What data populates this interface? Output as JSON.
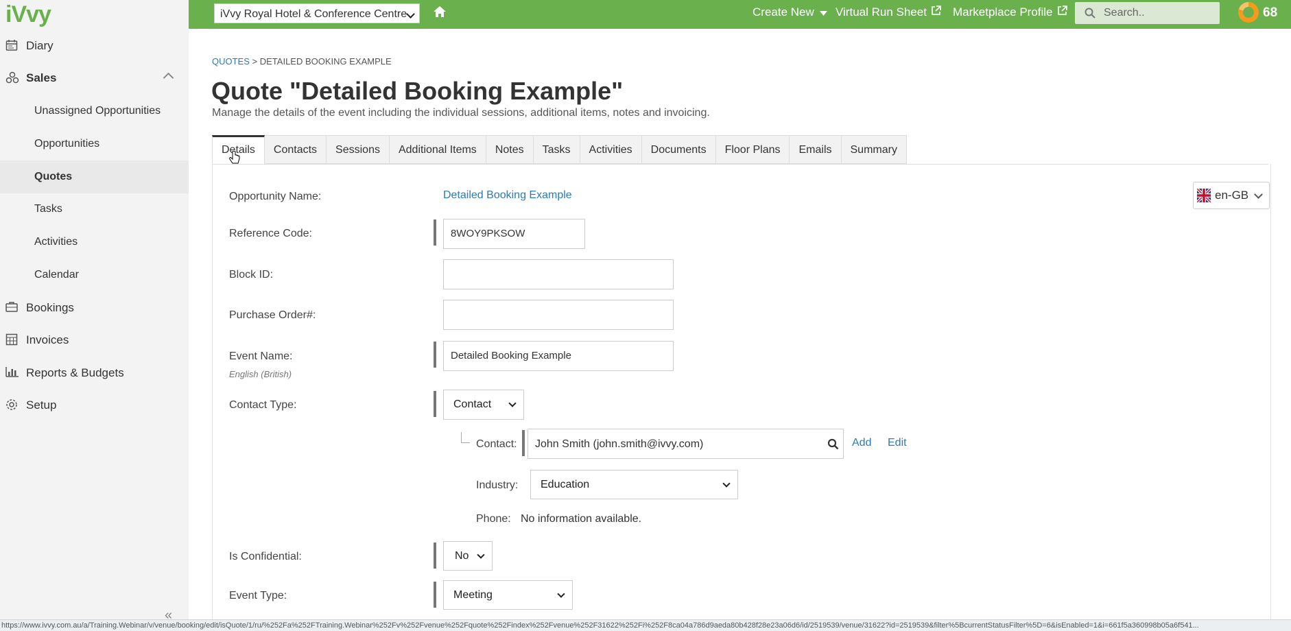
{
  "app": {
    "logo": "iVvy"
  },
  "sidebar": {
    "items": [
      {
        "label": "Diary",
        "icon": "calendar-icon"
      },
      {
        "label": "Sales",
        "icon": "sales-icon"
      },
      {
        "label": "Unassigned Opportunities"
      },
      {
        "label": "Opportunities"
      },
      {
        "label": "Quotes"
      },
      {
        "label": "Tasks"
      },
      {
        "label": "Activities"
      },
      {
        "label": "Calendar"
      },
      {
        "label": "Bookings",
        "icon": "briefcase-icon"
      },
      {
        "label": "Invoices",
        "icon": "calculator-icon"
      },
      {
        "label": "Reports & Budgets",
        "icon": "bar-chart-icon"
      },
      {
        "label": "Setup",
        "icon": "gear-icon"
      }
    ],
    "collapse_glyph": "«"
  },
  "topbar": {
    "venue": "iVvy Royal Hotel & Conference Centre",
    "create_new": "Create New",
    "virtual_run_sheet": "Virtual Run Sheet",
    "marketplace_profile": "Marketplace Profile",
    "search_placeholder": "Search..",
    "score": "68",
    "colors": {
      "bar": "#6ab04c",
      "accent": "#f29b1f"
    }
  },
  "breadcrumb": {
    "root": "QUOTES",
    "separator": ">",
    "current": "DETAILED BOOKING EXAMPLE"
  },
  "page": {
    "title": "Quote \"Detailed Booking Example\"",
    "subtitle": "Manage the details of the event including the individual sessions, additional items, notes and invoicing."
  },
  "tabs": [
    "Details",
    "Contacts",
    "Sessions",
    "Additional Items",
    "Notes",
    "Tasks",
    "Activities",
    "Documents",
    "Floor Plans",
    "Emails",
    "Summary"
  ],
  "language": "en-GB",
  "form": {
    "opportunity_name_label": "Opportunity Name:",
    "opportunity_name_value": "Detailed Booking Example",
    "reference_code_label": "Reference Code:",
    "reference_code_value": "8WOY9PKSOW",
    "block_id_label": "Block ID:",
    "block_id_value": "",
    "purchase_order_label": "Purchase Order#:",
    "purchase_order_value": "",
    "event_name_label": "Event Name:",
    "event_name_sublabel": "English (British)",
    "event_name_value": "Detailed Booking Example",
    "contact_type_label": "Contact Type:",
    "contact_type_value": "Contact",
    "contact_label": "Contact:",
    "contact_value": "John Smith (john.smith@ivvy.com)",
    "add_label": "Add",
    "edit_label": "Edit",
    "industry_label": "Industry:",
    "industry_value": "Education",
    "phone_label": "Phone:",
    "phone_value": "No information available.",
    "confidential_label": "Is Confidential:",
    "confidential_value": "No",
    "event_type_label": "Event Type:",
    "event_type_value": "Meeting"
  },
  "statusbar": {
    "url": "https://www.ivvy.com.au/a/Training.Webinar/v/venue/booking/edit/isQuote/1/ru/%252Fa%252FTraining.Webinar%252Fv%252Fvenue%252Fquote%252Findex%252Fvenue%252F31622%252Fi%252F8ca04a786d9aeda80b428f28e23a06d6/id/2519539/venue/31622?id=2519539&filter%5BcurrentStatusFilter%5D=6&isEnabled=1&i=661f5a360998b05a6f541..."
  }
}
